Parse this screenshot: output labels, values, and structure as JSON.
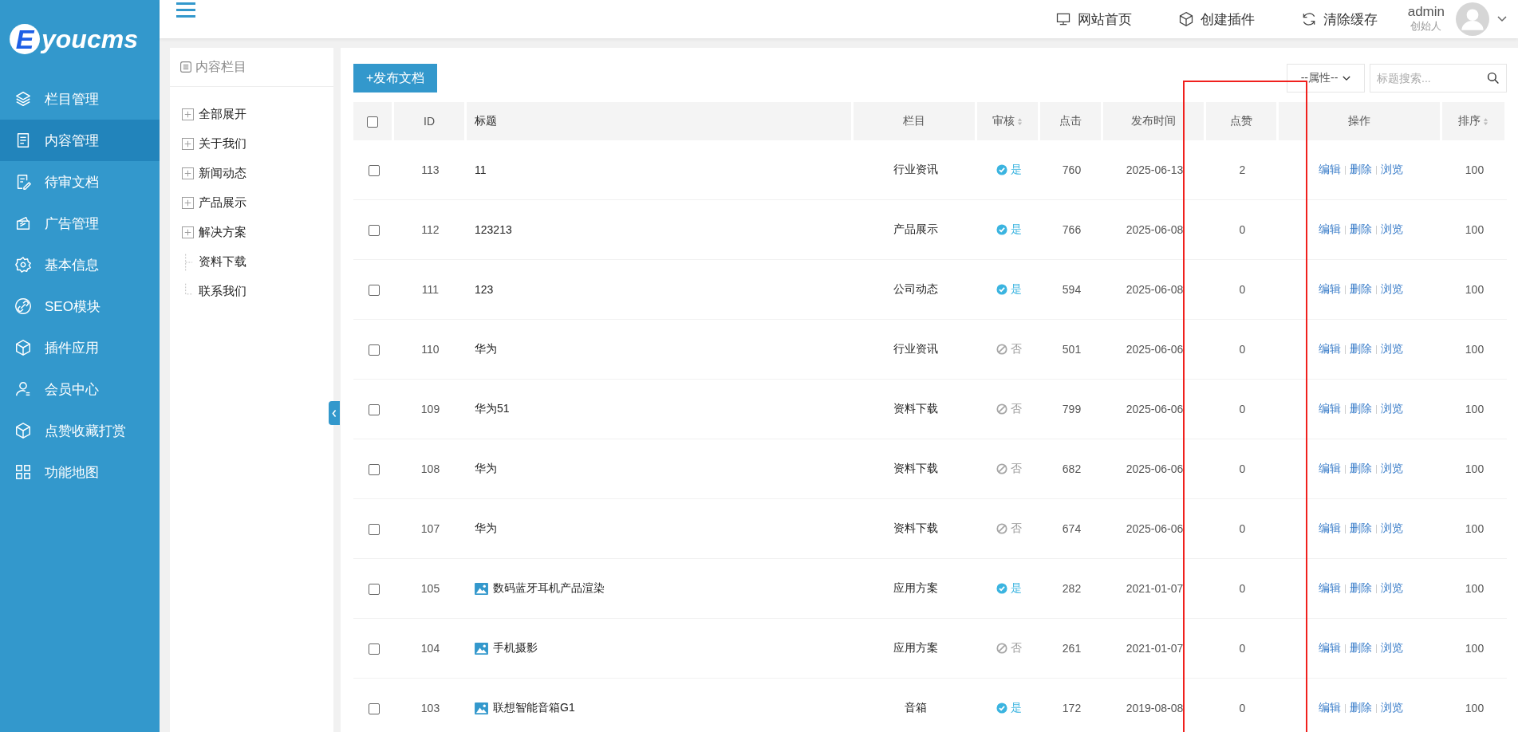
{
  "logo": {
    "badge": "E",
    "text": "youcms"
  },
  "sidebar": {
    "items": [
      {
        "label": "栏目管理",
        "selected": false
      },
      {
        "label": "内容管理",
        "selected": true
      },
      {
        "label": "待审文档",
        "selected": false
      },
      {
        "label": "广告管理",
        "selected": false
      },
      {
        "label": "基本信息",
        "selected": false
      },
      {
        "label": "SEO模块",
        "selected": false
      },
      {
        "label": "插件应用",
        "selected": false
      },
      {
        "label": "会员中心",
        "selected": false
      },
      {
        "label": "点赞收藏打赏",
        "selected": false
      },
      {
        "label": "功能地图",
        "selected": false
      }
    ]
  },
  "header": {
    "links": [
      {
        "label": "网站首页"
      },
      {
        "label": "创建插件"
      },
      {
        "label": "清除缓存"
      }
    ],
    "user": {
      "name": "admin",
      "role": "创始人"
    }
  },
  "tree": {
    "title": "内容栏目",
    "items": [
      {
        "label": "全部展开",
        "kind": "expandable"
      },
      {
        "label": "关于我们",
        "kind": "expandable"
      },
      {
        "label": "新闻动态",
        "kind": "expandable"
      },
      {
        "label": "产品展示",
        "kind": "expandable"
      },
      {
        "label": "解决方案",
        "kind": "expandable"
      },
      {
        "label": "资料下载",
        "kind": "leaf"
      },
      {
        "label": "联系我们",
        "kind": "leaf"
      }
    ]
  },
  "toolbar": {
    "publish_button": "+发布文档",
    "filter": {
      "value": "--属性--"
    },
    "search": {
      "placeholder": "标题搜索..."
    }
  },
  "table": {
    "columns": [
      {
        "kind": "checkbox",
        "checked": false
      },
      {
        "label": "ID",
        "sortable": false
      },
      {
        "label": "标题",
        "sortable": false
      },
      {
        "label": "栏目",
        "sortable": false
      },
      {
        "label": "审核",
        "sortable": true
      },
      {
        "label": "点击",
        "sortable": false
      },
      {
        "label": "发布时间",
        "sortable": false
      },
      {
        "label": "点赞",
        "sortable": false
      },
      {
        "label": "操作",
        "sortable": false
      },
      {
        "label": "排序",
        "sortable": true
      }
    ],
    "rows": [
      {
        "checked": false,
        "id": "113",
        "title": "11",
        "has_image": false,
        "category": "行业资讯",
        "approved": true,
        "approved_label": "是",
        "clicks": "760",
        "date": "2025-06-13",
        "likes": "2",
        "actions": [
          "编辑",
          "删除",
          "浏览"
        ],
        "sort": "100"
      },
      {
        "checked": false,
        "id": "112",
        "title": "123213",
        "has_image": false,
        "category": "产品展示",
        "approved": true,
        "approved_label": "是",
        "clicks": "766",
        "date": "2025-06-08",
        "likes": "0",
        "actions": [
          "编辑",
          "删除",
          "浏览"
        ],
        "sort": "100"
      },
      {
        "checked": false,
        "id": "111",
        "title": "123",
        "has_image": false,
        "category": "公司动态",
        "approved": true,
        "approved_label": "是",
        "clicks": "594",
        "date": "2025-06-08",
        "likes": "0",
        "actions": [
          "编辑",
          "删除",
          "浏览"
        ],
        "sort": "100"
      },
      {
        "checked": false,
        "id": "110",
        "title": "华为",
        "has_image": false,
        "category": "行业资讯",
        "approved": false,
        "approved_label": "否",
        "clicks": "501",
        "date": "2025-06-06",
        "likes": "0",
        "actions": [
          "编辑",
          "删除",
          "浏览"
        ],
        "sort": "100"
      },
      {
        "checked": false,
        "id": "109",
        "title": "华为51",
        "has_image": false,
        "category": "资料下载",
        "approved": false,
        "approved_label": "否",
        "clicks": "799",
        "date": "2025-06-06",
        "likes": "0",
        "actions": [
          "编辑",
          "删除",
          "浏览"
        ],
        "sort": "100"
      },
      {
        "checked": false,
        "id": "108",
        "title": "华为",
        "has_image": false,
        "category": "资料下载",
        "approved": false,
        "approved_label": "否",
        "clicks": "682",
        "date": "2025-06-06",
        "likes": "0",
        "actions": [
          "编辑",
          "删除",
          "浏览"
        ],
        "sort": "100"
      },
      {
        "checked": false,
        "id": "107",
        "title": "华为",
        "has_image": false,
        "category": "资料下载",
        "approved": false,
        "approved_label": "否",
        "clicks": "674",
        "date": "2025-06-06",
        "likes": "0",
        "actions": [
          "编辑",
          "删除",
          "浏览"
        ],
        "sort": "100"
      },
      {
        "checked": false,
        "id": "105",
        "title": "数码蓝牙耳机产品渲染",
        "has_image": true,
        "category": "应用方案",
        "approved": true,
        "approved_label": "是",
        "clicks": "282",
        "date": "2021-01-07",
        "likes": "0",
        "actions": [
          "编辑",
          "删除",
          "浏览"
        ],
        "sort": "100"
      },
      {
        "checked": false,
        "id": "104",
        "title": "手机摄影",
        "has_image": true,
        "category": "应用方案",
        "approved": false,
        "approved_label": "否",
        "clicks": "261",
        "date": "2021-01-07",
        "likes": "0",
        "actions": [
          "编辑",
          "删除",
          "浏览"
        ],
        "sort": "100"
      },
      {
        "checked": false,
        "id": "103",
        "title": "联想智能音箱G1",
        "has_image": true,
        "category": "音箱",
        "approved": true,
        "approved_label": "是",
        "clicks": "172",
        "date": "2019-08-08",
        "likes": "0",
        "actions": [
          "编辑",
          "删除",
          "浏览"
        ],
        "sort": "100"
      }
    ]
  }
}
